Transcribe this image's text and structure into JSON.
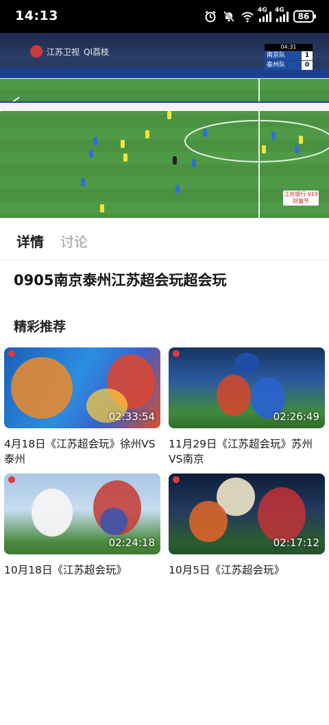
{
  "status_bar": {
    "time": "14:13",
    "net1": "4G",
    "net2": "4G",
    "battery": "86",
    "icons": [
      "alarm-icon",
      "mute-icon",
      "wifi-icon",
      "signal-icon",
      "signal-icon",
      "battery-icon"
    ]
  },
  "video": {
    "channel_logo": "江苏卫视",
    "app_logo": "QI荔枝",
    "scoreboard": {
      "clock": "04:31",
      "home_team": "南京队",
      "home_score": "1",
      "away_team": "泰州队",
      "away_score": "0"
    },
    "sponsor": "江苏银行 919财富节"
  },
  "tabs": [
    {
      "label": "详情",
      "active": true
    },
    {
      "label": "讨论",
      "active": false
    }
  ],
  "title": "0905南京泰州江苏超会玩超会玩",
  "section_title": "精彩推荐",
  "recommendations": [
    {
      "title": "4月18日《江苏超会玩》徐州VS泰州",
      "duration": "02:33:54"
    },
    {
      "title": "11月29日《江苏超会玩》苏州VS南京",
      "duration": "02:26:49"
    },
    {
      "title": "10月18日《江苏超会玩》",
      "duration": "02:24:18"
    },
    {
      "title": "10月5日《江苏超会玩》",
      "duration": "02:17:12"
    }
  ],
  "colors": {
    "status_bar_bg": "#000000",
    "active_tab": "#1a1a1a",
    "inactive_tab": "#9a9a9a",
    "pitch": "#4f9a46"
  }
}
